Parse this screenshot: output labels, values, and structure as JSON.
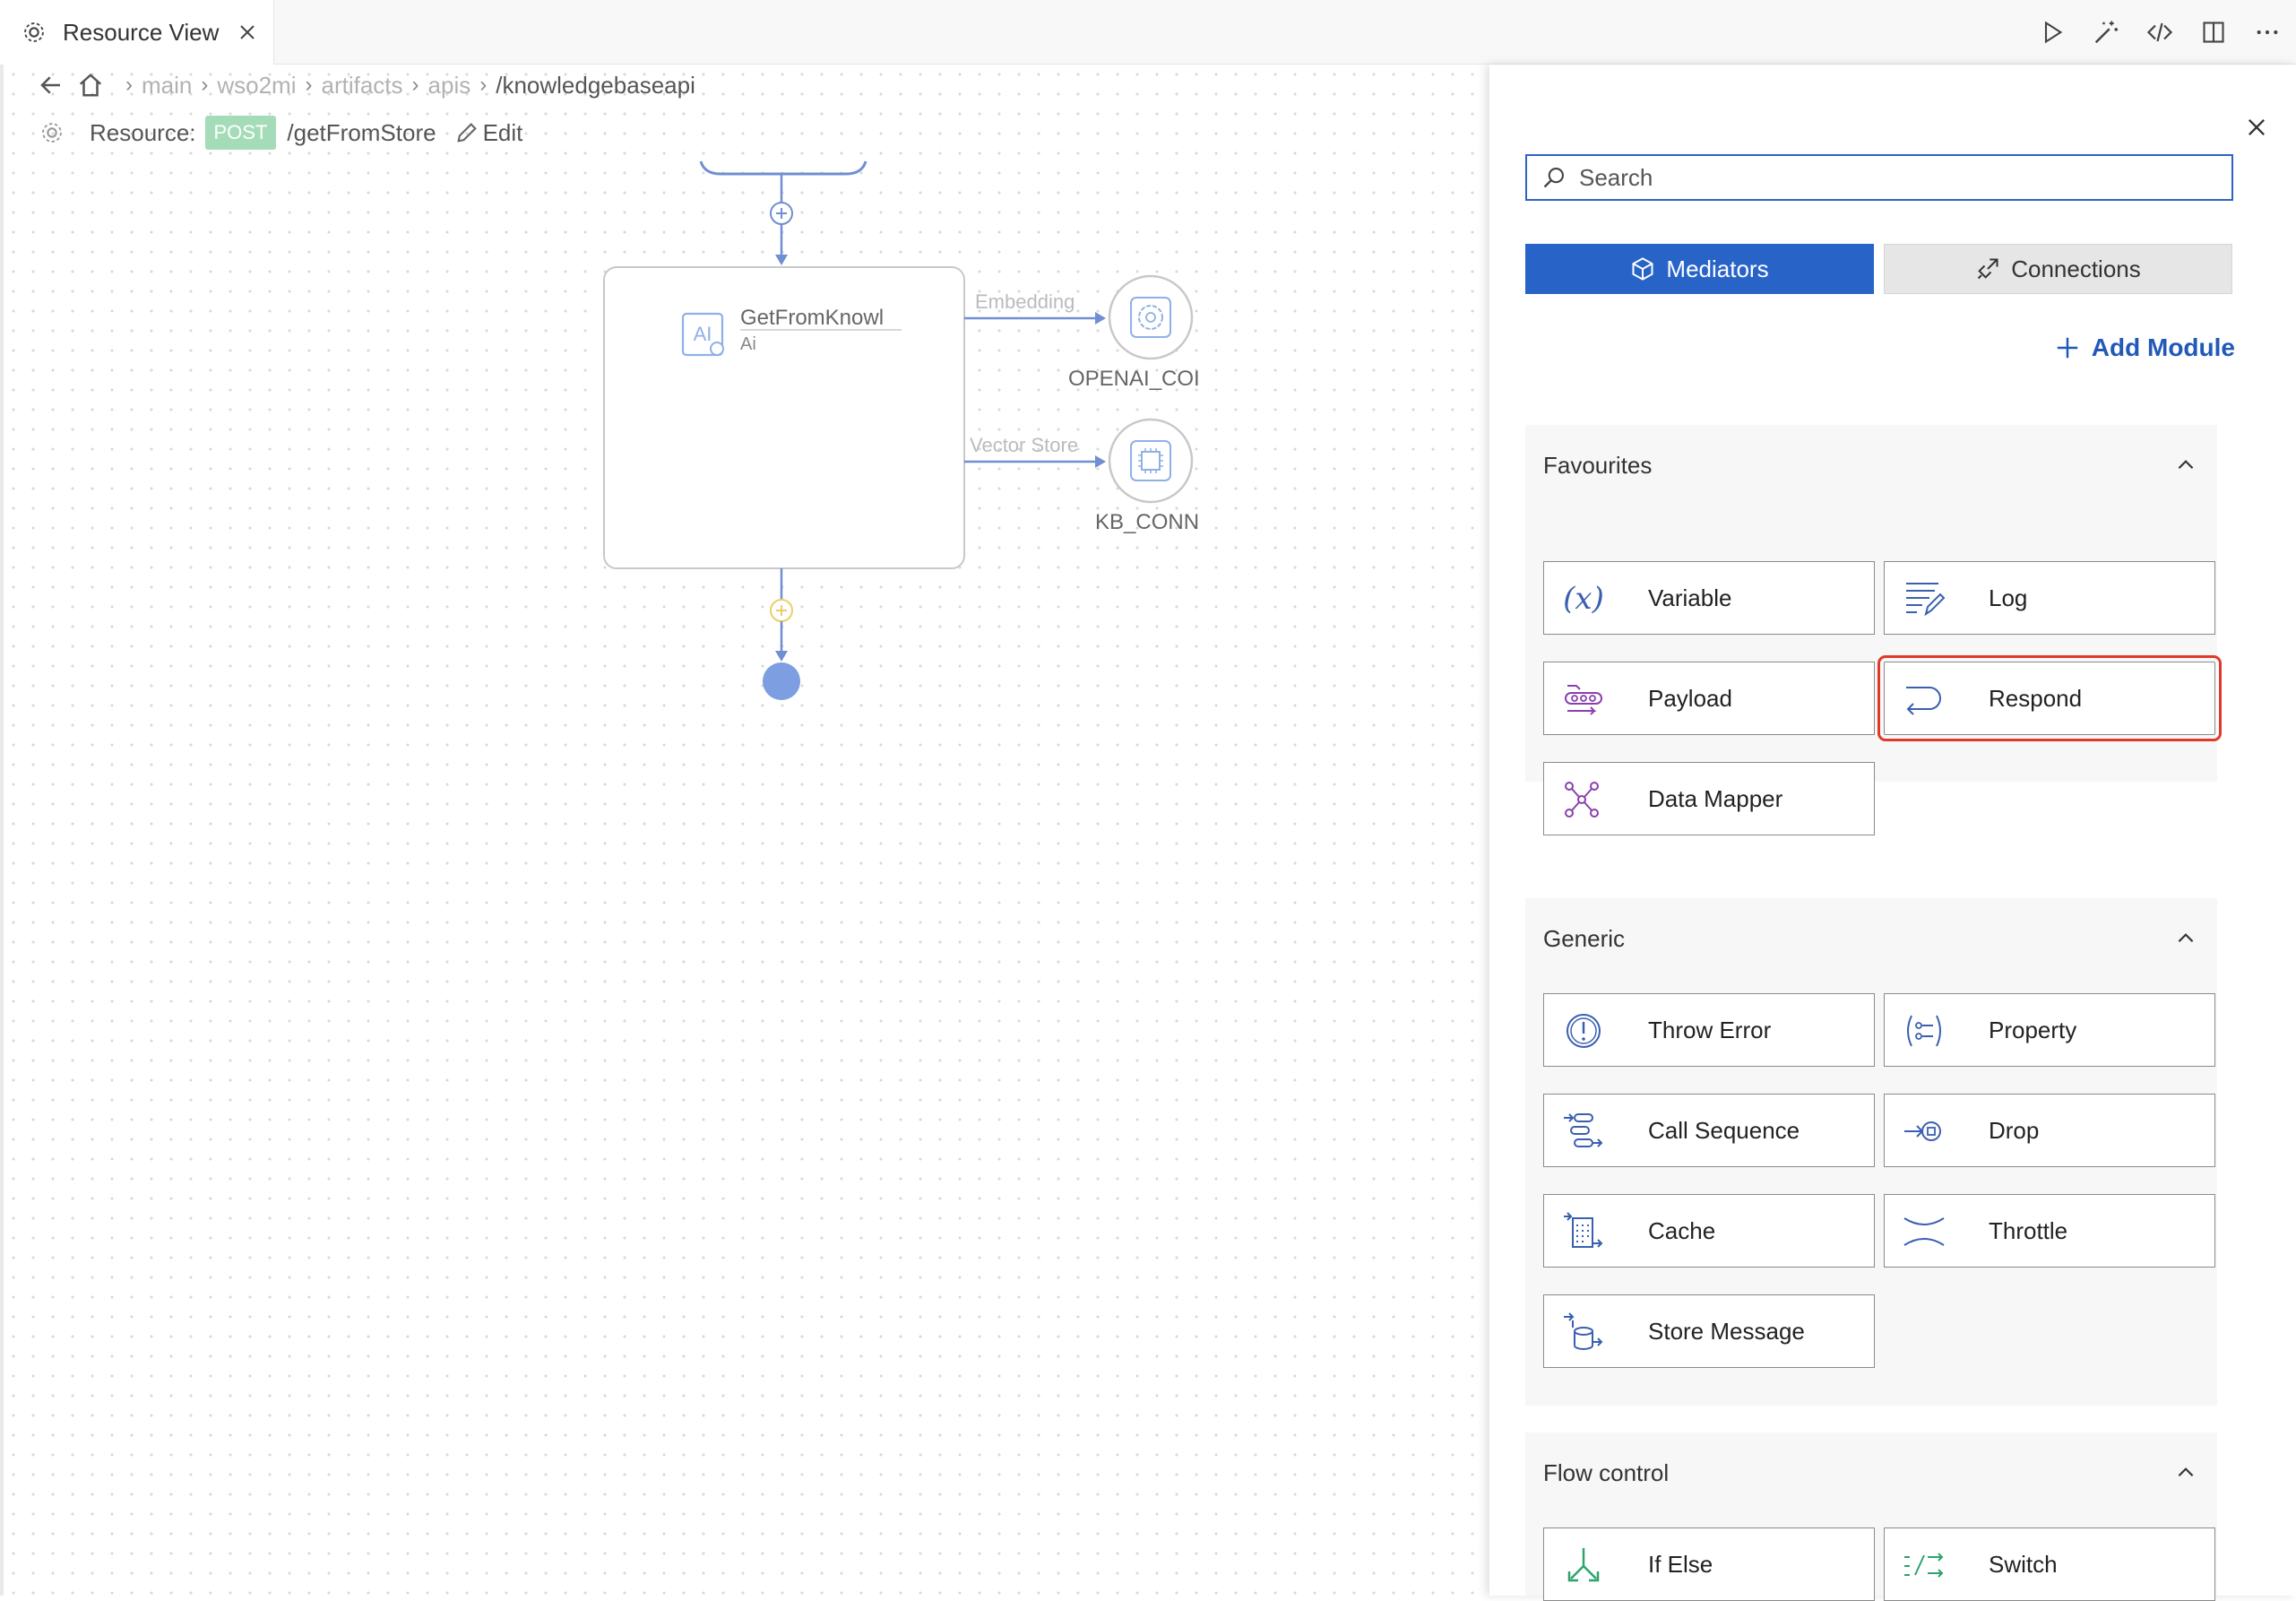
{
  "tab": {
    "title": "Resource View"
  },
  "breadcrumb": {
    "items": [
      "main",
      "wso2mi",
      "artifacts",
      "apis"
    ],
    "current": "/knowledgebaseapi"
  },
  "resource": {
    "label": "Resource:",
    "method": "POST",
    "path": "/getFromStore",
    "edit": "Edit"
  },
  "diagram": {
    "node_title": "GetFromKnowl",
    "node_subtitle": "Ai",
    "node_icon_text": "AI",
    "edge1_label": "Embedding",
    "edge2_label": "Vector Store",
    "conn1_label": "OPENAI_COI",
    "conn2_label": "KB_CONN"
  },
  "panel": {
    "search_placeholder": "Search",
    "tab_mediators": "Mediators",
    "tab_connections": "Connections",
    "add_module": "Add Module",
    "accent": "#2864c8",
    "highlight_color": "#e0392b"
  },
  "sections": {
    "favourites": {
      "title": "Favourites",
      "items": [
        {
          "label": "Variable",
          "icon": "variable-icon"
        },
        {
          "label": "Log",
          "icon": "log-icon"
        },
        {
          "label": "Payload",
          "icon": "payload-icon"
        },
        {
          "label": "Respond",
          "icon": "respond-icon"
        },
        {
          "label": "Data Mapper",
          "icon": "data-mapper-icon"
        }
      ]
    },
    "generic": {
      "title": "Generic",
      "items": [
        {
          "label": "Throw Error",
          "icon": "throw-error-icon"
        },
        {
          "label": "Property",
          "icon": "property-icon"
        },
        {
          "label": "Call Sequence",
          "icon": "call-sequence-icon"
        },
        {
          "label": "Drop",
          "icon": "drop-icon"
        },
        {
          "label": "Cache",
          "icon": "cache-icon"
        },
        {
          "label": "Throttle",
          "icon": "throttle-icon"
        },
        {
          "label": "Store Message",
          "icon": "store-message-icon"
        }
      ]
    },
    "flow_control": {
      "title": "Flow control",
      "items": [
        {
          "label": "If Else",
          "icon": "if-else-icon"
        },
        {
          "label": "Switch",
          "icon": "switch-icon"
        }
      ]
    }
  }
}
